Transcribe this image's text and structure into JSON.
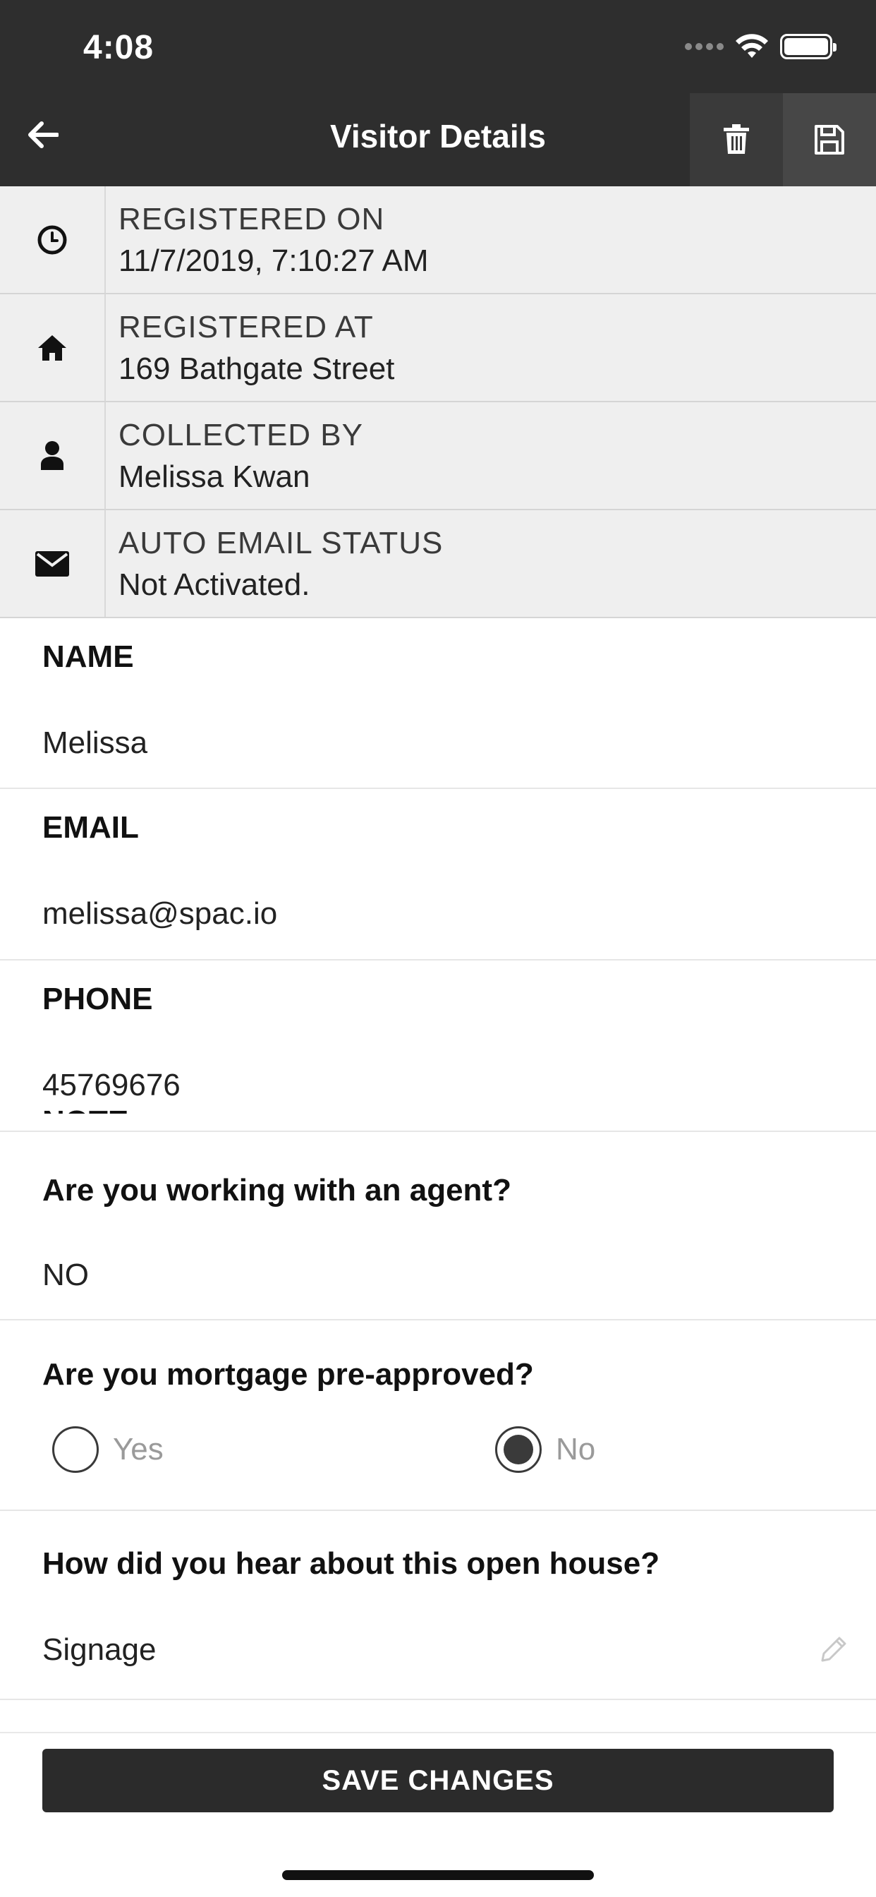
{
  "status_bar": {
    "time": "4:08"
  },
  "header": {
    "title": "Visitor Details"
  },
  "info_rows": [
    {
      "label": "REGISTERED ON",
      "value": "11/7/2019, 7:10:27 AM",
      "icon": "clock-icon"
    },
    {
      "label": "REGISTERED AT",
      "value": "169 Bathgate Street",
      "icon": "home-icon"
    },
    {
      "label": "COLLECTED BY",
      "value": "Melissa Kwan",
      "icon": "user-icon"
    },
    {
      "label": "AUTO EMAIL STATUS",
      "value": "Not Activated.",
      "icon": "envelope-icon"
    }
  ],
  "fields": {
    "name": {
      "label": "NAME",
      "value": "Melissa"
    },
    "email": {
      "label": "EMAIL",
      "value": "melissa@spac.io"
    },
    "phone": {
      "label": "PHONE",
      "value": "45769676"
    },
    "agent": {
      "label": "Are you working with an agent?",
      "value": "NO"
    },
    "mortgage": {
      "label": "Are you mortgage pre-approved?",
      "options": [
        "Yes",
        "No"
      ],
      "selected": "No"
    },
    "hear": {
      "label": "How did you hear about this open house?",
      "value": "Signage"
    },
    "note": {
      "label": "NOTE"
    }
  },
  "footer": {
    "save_label": "SAVE CHANGES"
  }
}
